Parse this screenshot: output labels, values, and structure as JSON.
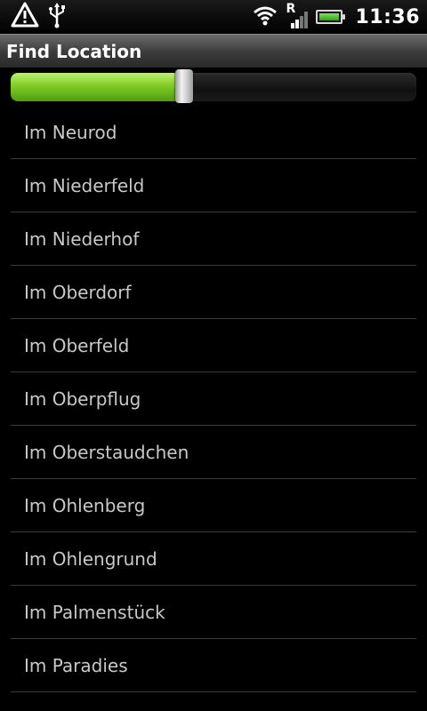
{
  "status_bar": {
    "time": "11:36",
    "left_icons": [
      "warning-icon",
      "usb-icon"
    ],
    "right_icons": [
      "wifi-icon",
      "roaming-signal-icon",
      "battery-icon"
    ],
    "roaming_label": "R"
  },
  "title_bar": {
    "title": "Find Location"
  },
  "slider": {
    "value_fraction": 0.425
  },
  "locations": [
    "Im Neurod",
    "Im Niederfeld",
    "Im Niederhof",
    "Im Oberdorf",
    "Im Oberfeld",
    "Im Oberpflug",
    "Im Oberstaudchen",
    "Im Ohlenberg",
    "Im Ohlengrund",
    "Im Palmenstück",
    "Im Paradies"
  ],
  "colors": {
    "slider_fill": "#86d128",
    "battery_fill": "#4fc22a",
    "background": "#000000"
  }
}
